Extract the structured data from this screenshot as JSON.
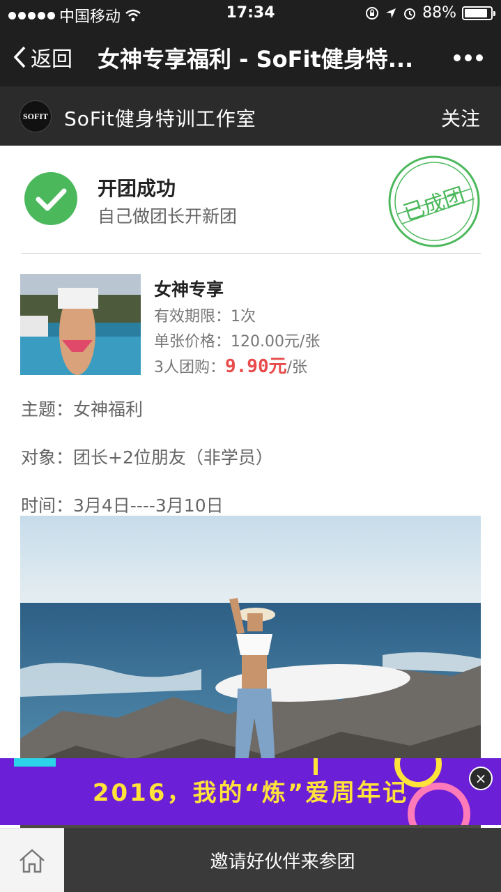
{
  "status_bar": {
    "carrier": "中国移动",
    "time": "17:34",
    "battery_percent": "88%",
    "battery_level": 0.88
  },
  "nav": {
    "back_label": "返回",
    "title": "女神专享福利 - SoFit健身特..."
  },
  "account": {
    "logo_text": "SOFIT",
    "name": "SoFit健身特训工作室",
    "follow_label": "关注"
  },
  "success": {
    "title": "开团成功",
    "subtitle": "自己做团长开新团",
    "stamp_text": "已成团"
  },
  "product": {
    "name": "女神专享",
    "validity_label": "有效期限：",
    "validity_value": "1次",
    "unit_price_label": "单张价格：",
    "unit_price_value": "120.00元/张",
    "group_label": "3人团购：",
    "group_price": "9.90元",
    "group_unit": "/张"
  },
  "details": {
    "theme": "主题：女神福利",
    "audience": "对象：团长+2位朋友（非学员）",
    "time": "时间：3月4日----3月10日"
  },
  "banner": {
    "text": "2016，我的“炼”爱周年记",
    "close_symbol": "×"
  },
  "bottom": {
    "invite_label": "邀请好伙伴来参团"
  },
  "colors": {
    "success_green": "#4cb85c",
    "price_red": "#e84b4b",
    "banner_purple": "#6b1fd6",
    "banner_text": "#ffe23a"
  }
}
